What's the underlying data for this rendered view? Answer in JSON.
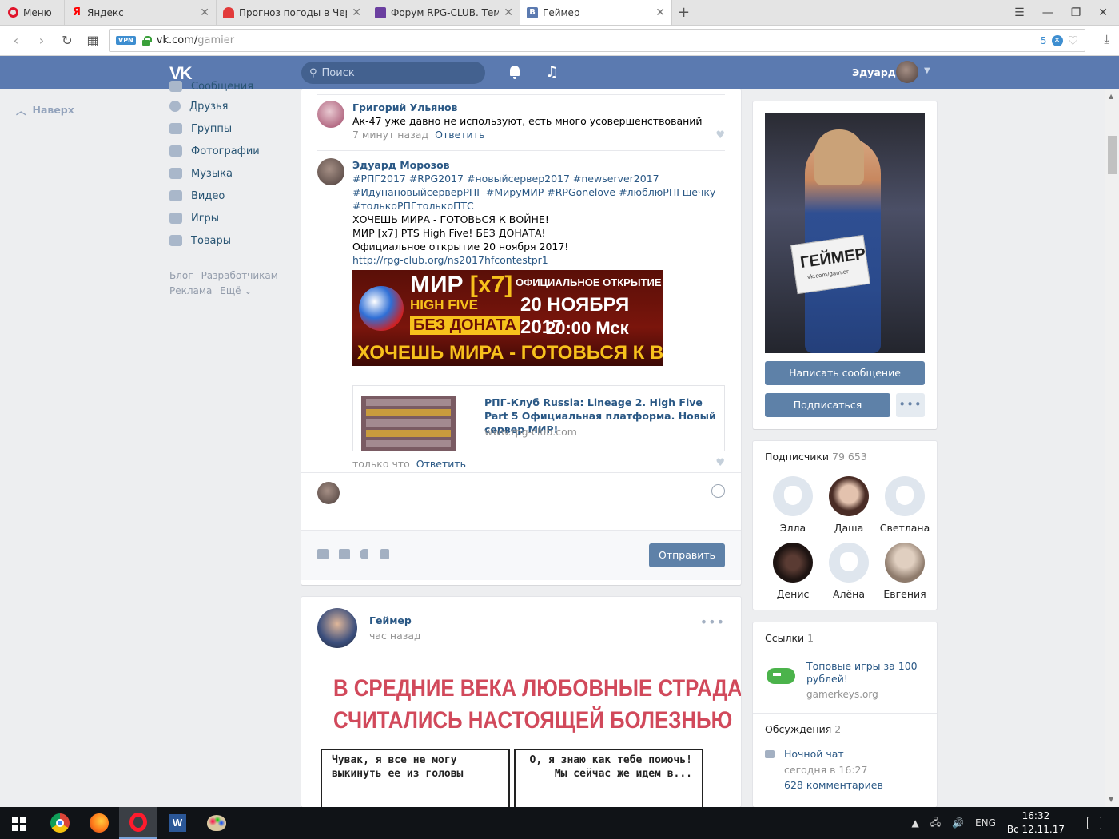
{
  "browser": {
    "menu_label": "Меню",
    "tabs": [
      {
        "label": "Яндекс",
        "fav": "Я",
        "fav_color": "#ff0000"
      },
      {
        "label": "Прогноз погоды в Черн",
        "fav": "",
        "fav_color": "#e23a3a"
      },
      {
        "label": "Форум RPG-CLUB. Тема: М",
        "fav": "",
        "fav_color": "#6b3fa0"
      },
      {
        "label": "Геймер",
        "fav": "В",
        "fav_color": "#5b7ab0"
      }
    ],
    "url_host": "vk.com/",
    "url_path": "gamier",
    "vpn_label": "VPN",
    "adblock_count": "5"
  },
  "header": {
    "logo": "VK",
    "search_placeholder": "Поиск",
    "user_name": "Эдуард"
  },
  "leftnav": {
    "back_to_top": "Наверх",
    "items": [
      {
        "label": "Сообщения"
      },
      {
        "label": "Друзья"
      },
      {
        "label": "Группы"
      },
      {
        "label": "Фотографии"
      },
      {
        "label": "Музыка"
      },
      {
        "label": "Видео"
      },
      {
        "label": "Игры"
      },
      {
        "label": "Товары"
      }
    ],
    "footer": [
      "Блог",
      "Разработчикам",
      "Реклама",
      "Ещё ⌄"
    ]
  },
  "comments": [
    {
      "author": "Григорий Ульянов",
      "text": "Ак-47 уже давно не используют, есть много усовершенствований",
      "time": "7 минут назад",
      "reply": "Ответить"
    },
    {
      "author": "Эдуард Морозов",
      "tags_line1": "#РПГ2017 #RPG2017 #новыйсервер2017 #newserver2017",
      "tags_line2": "#ИдунановыйсерверРПГ #МируМИР #RPGonelove #люблюРПГшечку",
      "tags_line3": "#толькоРПГтолькоПТС",
      "text_line1": "ХОЧЕШЬ МИРА - ГОТОВЬСЯ К ВОЙНЕ!",
      "text_line2": "МИР [x7] PTS High Five! БЕЗ ДОНАТА!",
      "text_line3": "Официальное открытие 20 ноября 2017!",
      "link": "http://rpg-club.org/ns2017hfcontestpr1",
      "time": "только что",
      "reply": "Ответить"
    }
  ],
  "banner": {
    "mir": "МИР",
    "x7": "[x7]",
    "high_five": "HIGH FIVE",
    "official": "ОФИЦИАЛЬНОЕ ОТКРЫТИЕ",
    "no_donate": "БЕЗ ДОНАТА",
    "date": "20 НОЯБРЯ 2017",
    "time": "20:00 Мск",
    "slogan": "ХОЧЕШЬ МИРА - ГОТОВЬСЯ К ВОЙНЕ"
  },
  "link_card": {
    "title": "РПГ-Клуб Russia: Lineage 2. High Five Part 5 Официальная платформа. Новый сервер МИР!",
    "domain": "www.rpg-club.com"
  },
  "reply_box": {
    "send_label": "Отправить"
  },
  "post2": {
    "author": "Геймер",
    "time": "час назад",
    "headline_line1": "В СРЕДНИЕ ВЕКА ЛЮБОВНЫЕ СТРАДАНИЯ",
    "headline_line2": "СЧИТАЛИСЬ НАСТОЯЩЕЙ БОЛЕЗНЬЮ",
    "panel_left": "Чувак, я все не могу выкинуть ее из головы",
    "panel_right": "О, я знаю как тебе помочь! Мы сейчас же идем в..."
  },
  "profile": {
    "sign_text": "ГЕЙМЕР",
    "sign_sub": "vk.com/gamier",
    "write_message": "Написать сообщение",
    "subscribe": "Подписаться",
    "more": "•••"
  },
  "subscribers": {
    "title": "Подписчики",
    "count": "79 653",
    "list": [
      {
        "name": "Элла",
        "default": true
      },
      {
        "name": "Даша",
        "default": false,
        "color": "#6b4a3f"
      },
      {
        "name": "Светлана",
        "default": true
      },
      {
        "name": "Денис",
        "default": false,
        "color": "#2a1c18"
      },
      {
        "name": "Алёна",
        "default": true
      },
      {
        "name": "Евгения",
        "default": false,
        "color": "#b8a79a"
      }
    ]
  },
  "links_block": {
    "title": "Ссылки",
    "count": "1",
    "item_title": "Топовые игры за 100 рублей!",
    "item_domain": "gamerkeys.org"
  },
  "discussions": {
    "title": "Обсуждения",
    "count": "2",
    "item_title": "Ночной чат",
    "item_time": "сегодня в 16:27",
    "item_comments": "628 комментариев"
  },
  "taskbar": {
    "lang": "ENG",
    "time": "16:32",
    "date": "Вс 12.11.17"
  }
}
